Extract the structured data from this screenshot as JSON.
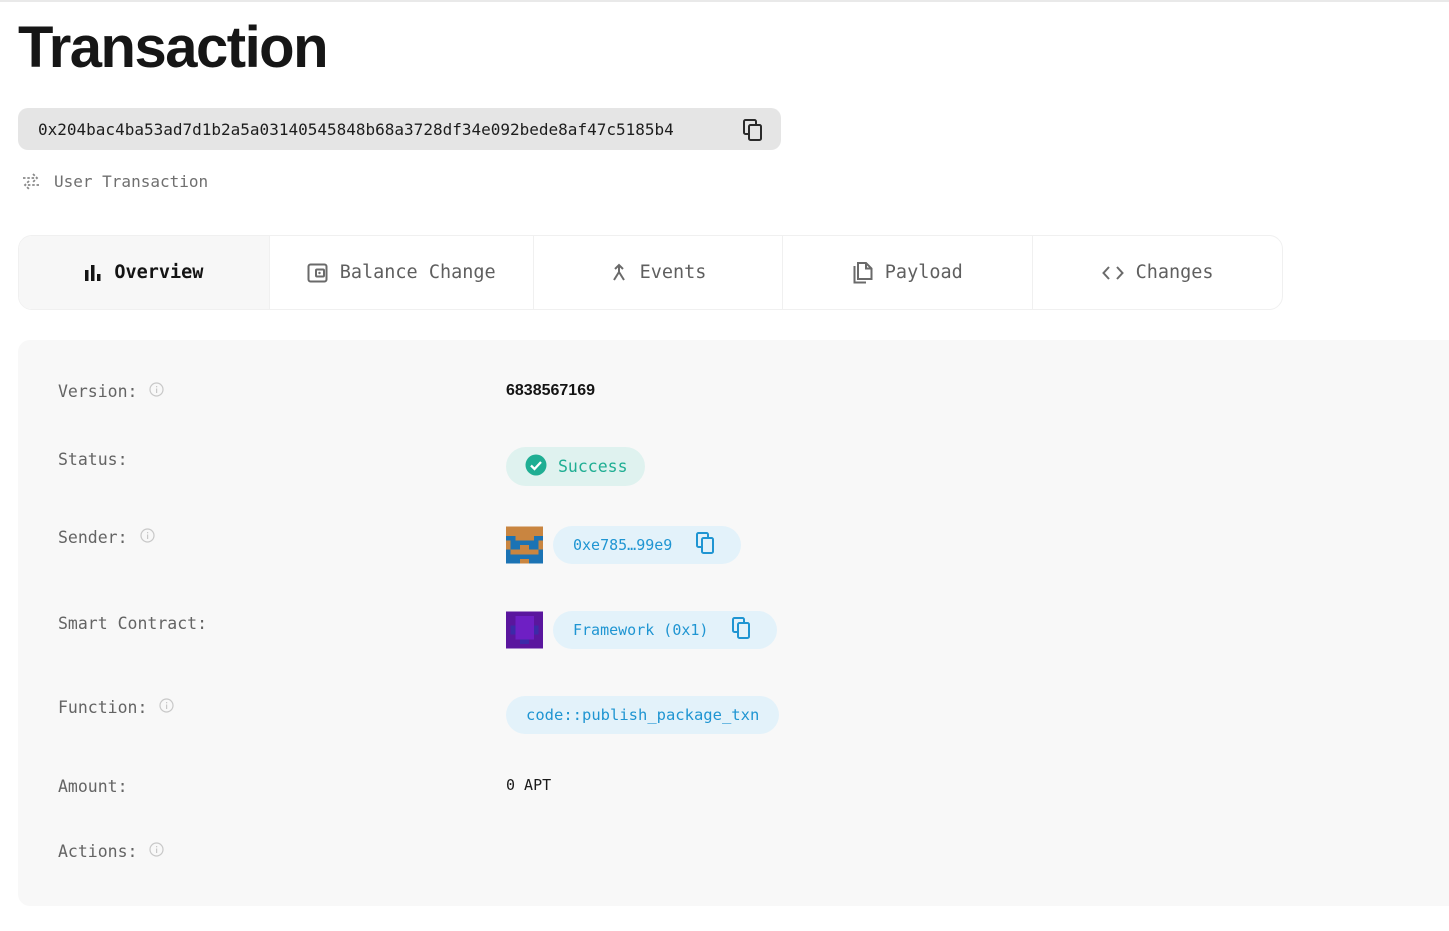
{
  "page": {
    "title": "Transaction",
    "hash": "0x204bac4ba53ad7d1b2a5a03140545848b68a3728df34e092bede8af47c5185b4",
    "tx_type": "User Transaction"
  },
  "tabs": [
    {
      "label": "Overview",
      "icon": "bar-chart-icon",
      "active": true
    },
    {
      "label": "Balance Change",
      "icon": "wallet-icon",
      "active": false
    },
    {
      "label": "Events",
      "icon": "merge-arrow-icon",
      "active": false
    },
    {
      "label": "Payload",
      "icon": "document-icon",
      "active": false
    },
    {
      "label": "Changes",
      "icon": "code-icon",
      "active": false
    }
  ],
  "overview": {
    "version_label": "Version:",
    "version": "6838567169",
    "status_label": "Status:",
    "status": "Success",
    "sender_label": "Sender:",
    "sender": "0xe785…99e9",
    "contract_label": "Smart Contract:",
    "contract": "Framework (0x1)",
    "function_label": "Function:",
    "function": "code::publish_package_txn",
    "amount_label": "Amount:",
    "amount": "0 APT",
    "actions_label": "Actions:"
  },
  "colors": {
    "success": "#1fae93",
    "link": "#1f95d2",
    "pill_bg": "#e3f2fa",
    "panel_bg": "#f8f8f8"
  }
}
